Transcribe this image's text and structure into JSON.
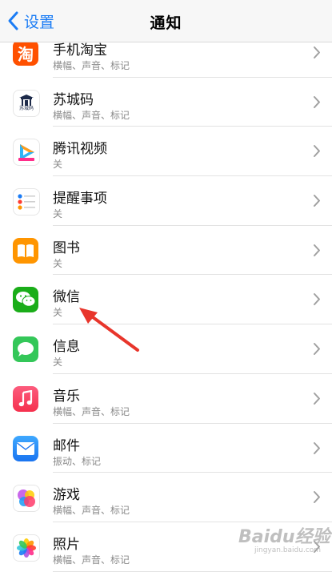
{
  "navbar": {
    "back_label": "设置",
    "title": "通知"
  },
  "apps": [
    {
      "name": "手机淘宝",
      "sub": "横幅、声音、标记",
      "icon": "taobao-icon"
    },
    {
      "name": "苏城码",
      "sub": "横幅、声音、标记",
      "icon": "suchengma-icon"
    },
    {
      "name": "腾讯视频",
      "sub": "关",
      "icon": "tencent-video-icon"
    },
    {
      "name": "提醒事项",
      "sub": "关",
      "icon": "reminders-icon"
    },
    {
      "name": "图书",
      "sub": "关",
      "icon": "books-icon"
    },
    {
      "name": "微信",
      "sub": "关",
      "icon": "wechat-icon"
    },
    {
      "name": "信息",
      "sub": "关",
      "icon": "messages-icon"
    },
    {
      "name": "音乐",
      "sub": "横幅、声音、标记",
      "icon": "music-icon"
    },
    {
      "name": "邮件",
      "sub": "振动、标记",
      "icon": "mail-icon"
    },
    {
      "name": "游戏",
      "sub": "横幅、声音、标记",
      "icon": "game-center-icon"
    },
    {
      "name": "照片",
      "sub": "横幅、声音、标记",
      "icon": "photos-icon"
    }
  ],
  "icon_labels": {
    "taobao": "淘",
    "suchengma": "苏城码"
  },
  "watermark": {
    "brand": "Baidu经验",
    "url": "jingyan.baidu.com"
  },
  "colors": {
    "accent": "#1a7cf5",
    "arrow": "#e8352b"
  }
}
